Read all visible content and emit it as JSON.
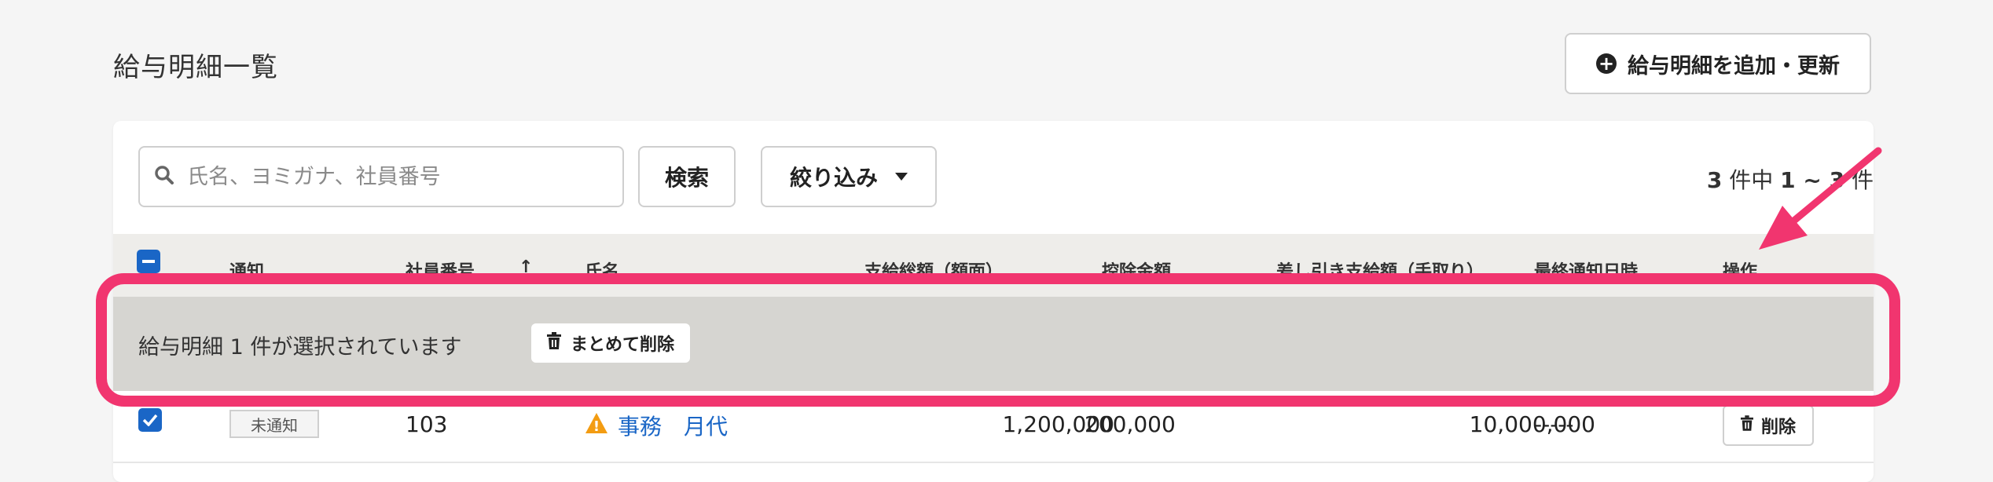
{
  "page": {
    "title": "給与明細一覧"
  },
  "header": {
    "add_button_label": "給与明細を追加・更新"
  },
  "search": {
    "placeholder": "氏名、ヨミガナ、社員番号",
    "value": ""
  },
  "toolbar": {
    "search_label": "検索",
    "filter_label": "絞り込み"
  },
  "pagination": {
    "total": "3",
    "mid": " 件中 ",
    "range": "1 ~ 3",
    "suffix": " 件"
  },
  "table": {
    "columns": {
      "notice": "通知",
      "employee_no": "社員番号",
      "sort_arrow": "↑",
      "name": "氏名",
      "gross": "支給総額（額面）",
      "deduction": "控除金額",
      "net": "差し引き支給額（手取り）",
      "last_notified": "最終通知日時",
      "actions": "操作"
    },
    "rows": [
      {
        "status": "未通知",
        "employee_no": "103",
        "warning": "!",
        "name": "事務　月代",
        "gross": "1,200,000",
        "deduction": "200,000",
        "net": "10,000,000",
        "last_notified": "-----",
        "delete_label": "削除"
      }
    ]
  },
  "selection": {
    "message": "給与明細 1 件が選択されています",
    "bulk_delete_label": "まとめて削除"
  },
  "colors": {
    "accent": "#1a66c6",
    "highlight": "#f1356f",
    "warning": "#f39c12"
  }
}
